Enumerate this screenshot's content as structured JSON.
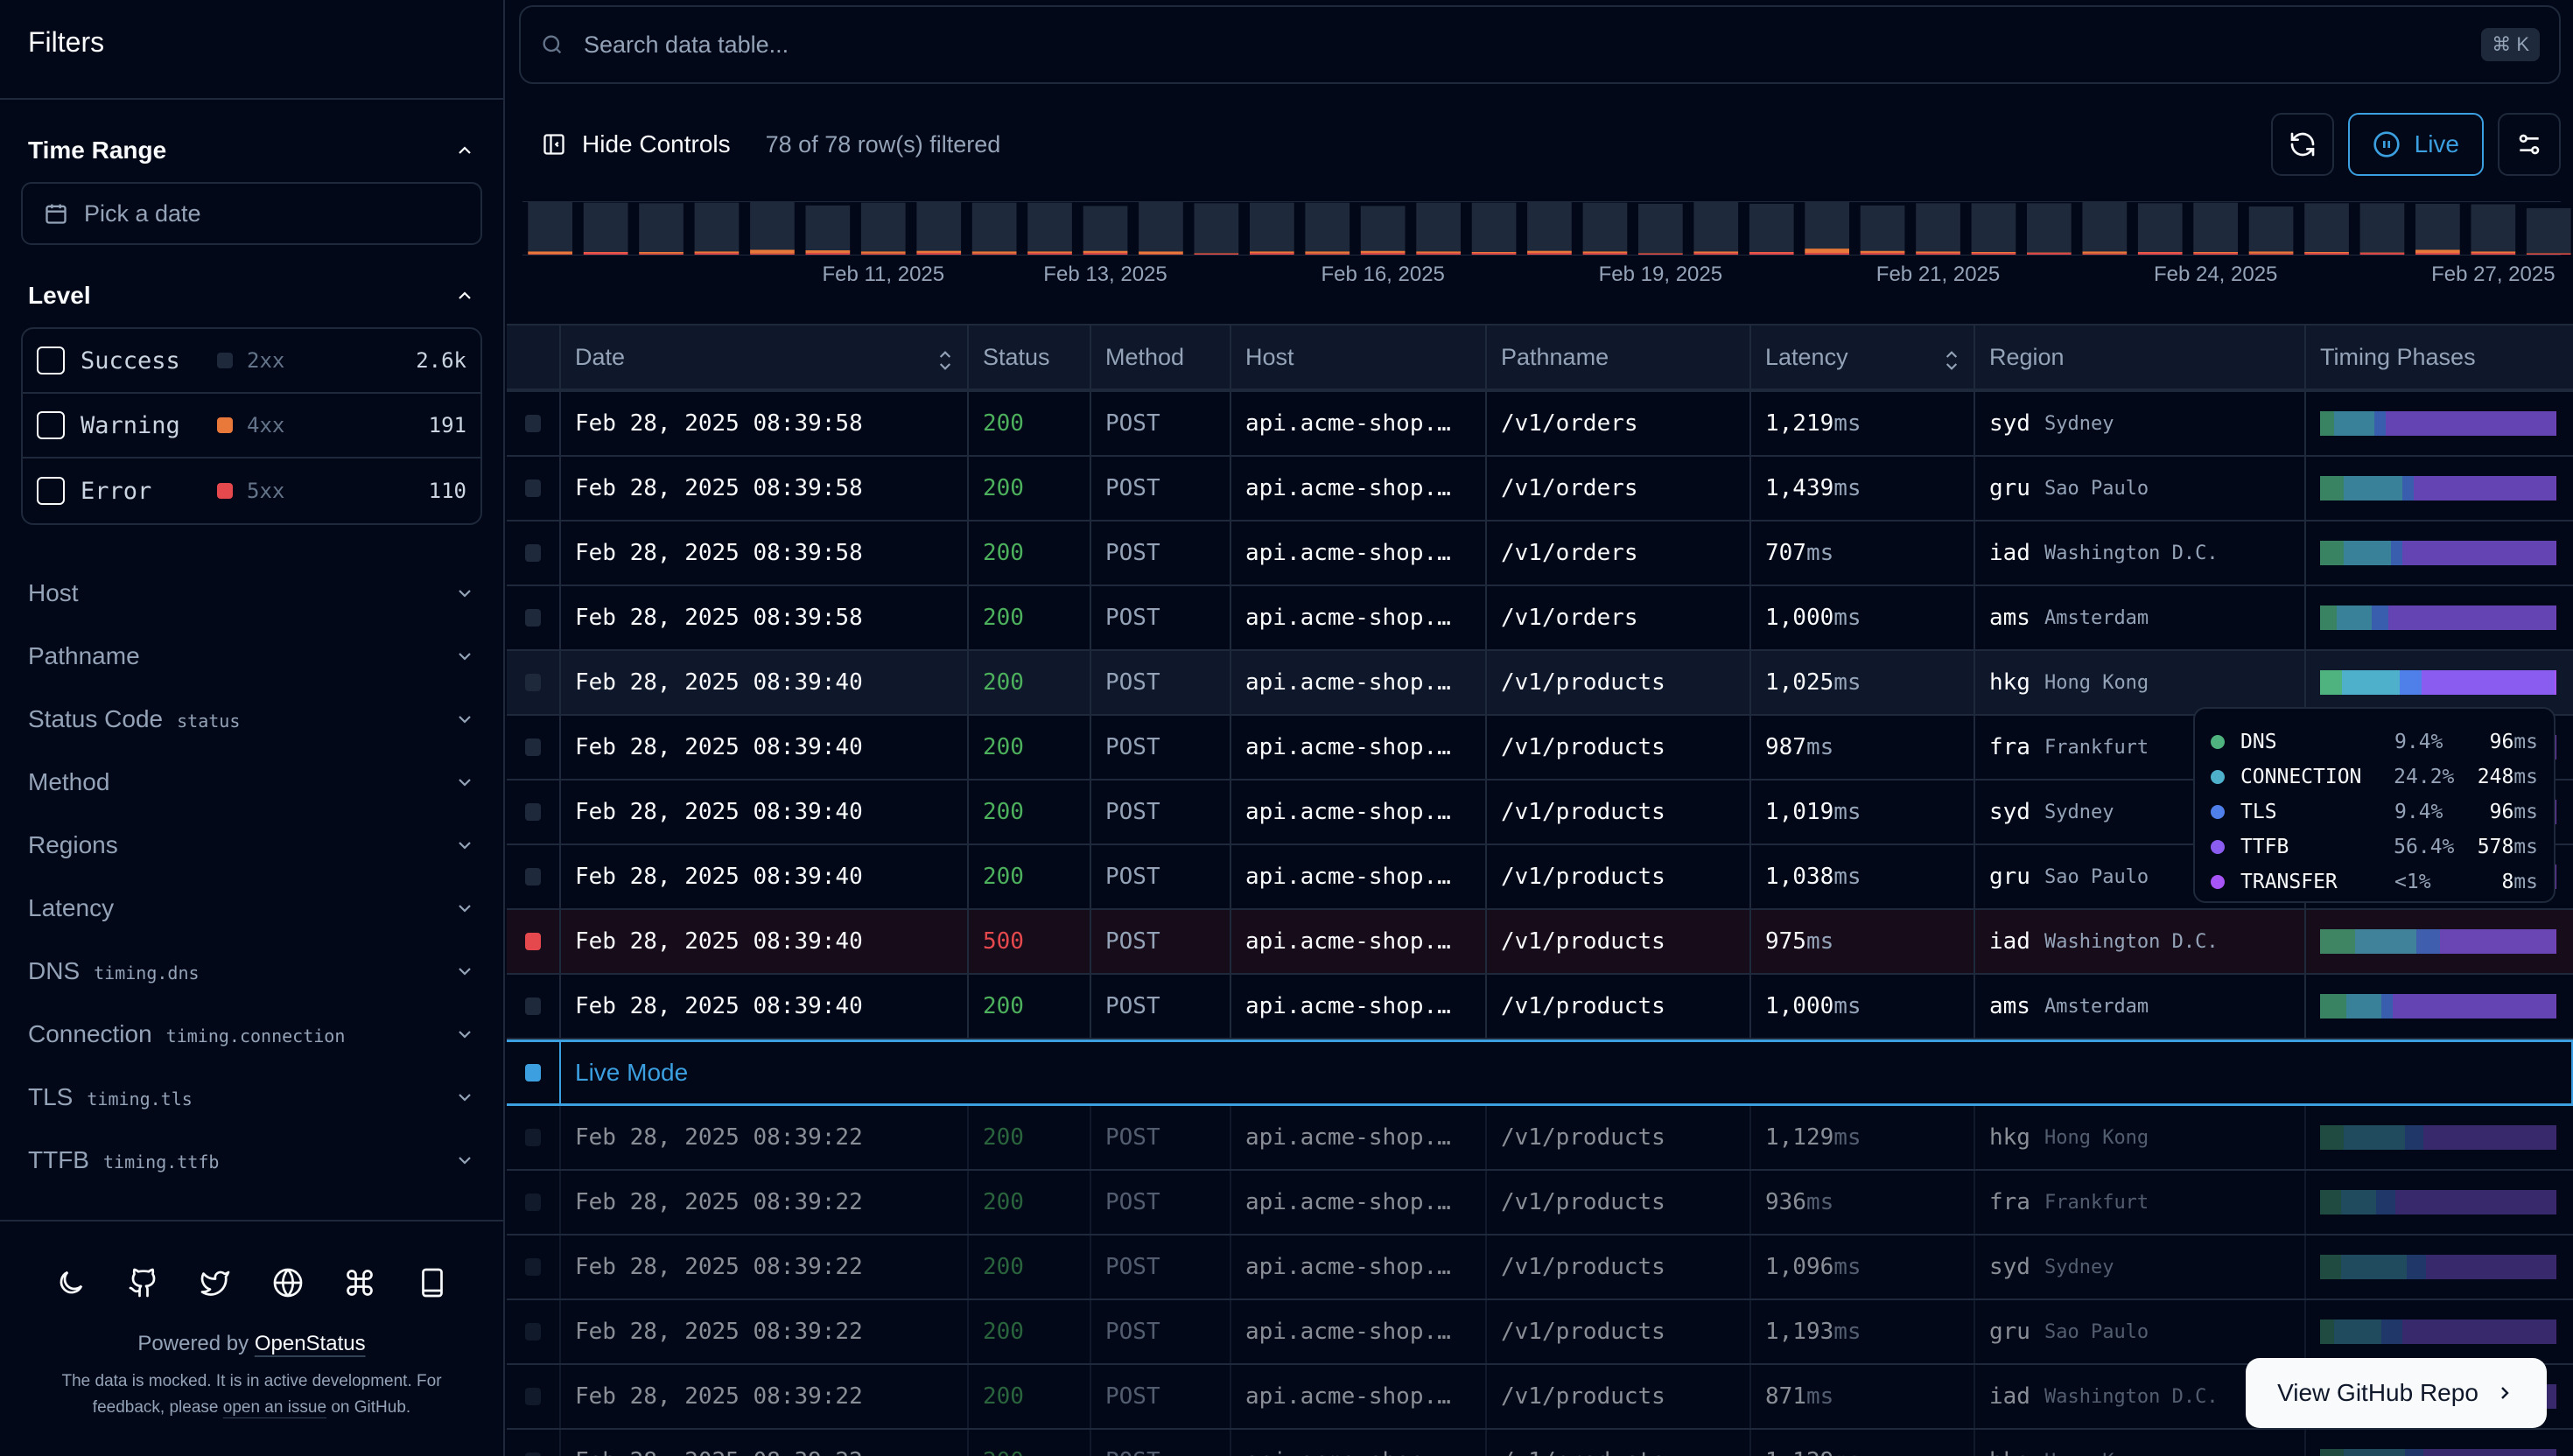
{
  "sidebar": {
    "title": "Filters",
    "time_range": {
      "label": "Time Range",
      "placeholder": "Pick a date"
    },
    "level": {
      "label": "Level",
      "items": [
        {
          "name": "Success",
          "code": "2xx",
          "count": "2.6k",
          "color": "#1e293b"
        },
        {
          "name": "Warning",
          "code": "4xx",
          "count": "191",
          "color": "#e8793a"
        },
        {
          "name": "Error",
          "code": "5xx",
          "count": "110",
          "color": "#e5484d"
        }
      ]
    },
    "filter_groups": [
      {
        "label": "Host",
        "sub": ""
      },
      {
        "label": "Pathname",
        "sub": ""
      },
      {
        "label": "Status Code",
        "sub": "status"
      },
      {
        "label": "Method",
        "sub": ""
      },
      {
        "label": "Regions",
        "sub": ""
      },
      {
        "label": "Latency",
        "sub": ""
      },
      {
        "label": "DNS",
        "sub": "timing.dns"
      },
      {
        "label": "Connection",
        "sub": "timing.connection"
      },
      {
        "label": "TLS",
        "sub": "timing.tls"
      },
      {
        "label": "TTFB",
        "sub": "timing.ttfb"
      }
    ],
    "footer": {
      "icons": [
        "moon-icon",
        "github-icon",
        "twitter-icon",
        "globe-icon",
        "command-icon",
        "book-icon"
      ],
      "powered_prefix": "Powered by",
      "powered_link": "OpenStatus",
      "notice_1": "The data is mocked. It is in active development. For feedback, please",
      "notice_link": "open an issue",
      "notice_2": "on GitHub."
    }
  },
  "search": {
    "placeholder": "Search data table...",
    "shortcut": "⌘ K"
  },
  "controls": {
    "hide_controls": "Hide Controls",
    "row_count": "78 of 78 row(s) filtered",
    "live_label": "Live"
  },
  "histogram": {
    "labels": [
      {
        "text": "Feb 11, 2025",
        "index": 6
      },
      {
        "text": "Feb 13, 2025",
        "index": 10
      },
      {
        "text": "Feb 16, 2025",
        "index": 15
      },
      {
        "text": "Feb 19, 2025",
        "index": 20
      },
      {
        "text": "Feb 21, 2025",
        "index": 25
      },
      {
        "text": "Feb 24, 2025",
        "index": 30
      },
      {
        "text": "Feb 27, 2025",
        "index": 35
      }
    ],
    "colors": {
      "success": "#1e293b",
      "warning": "#e8793a",
      "error": "#e5484d"
    }
  },
  "chart_data": {
    "type": "bar",
    "title": "",
    "stacked": true,
    "categories_count": 37,
    "series": [
      {
        "name": "Success",
        "values": [
          90,
          90,
          89,
          89,
          88,
          82,
          89,
          89,
          89,
          89,
          82,
          90,
          91,
          89,
          89,
          82,
          89,
          90,
          89,
          89,
          90,
          90,
          88,
          92,
          83,
          88,
          89,
          90,
          90,
          89,
          90,
          82,
          89,
          90,
          84,
          86,
          82
        ]
      },
      {
        "name": "Warning",
        "values": [
          5,
          1,
          3,
          3,
          7,
          5,
          4,
          4,
          4,
          3,
          4,
          5,
          1,
          3,
          4,
          4,
          3,
          2,
          4,
          3,
          1,
          3,
          1,
          8,
          4,
          3,
          2,
          1,
          4,
          1,
          2,
          4,
          2,
          1,
          6,
          3,
          1
        ]
      },
      {
        "name": "Error",
        "values": [
          1,
          4,
          2,
          3,
          2,
          3,
          2,
          3,
          2,
          3,
          3,
          1,
          2,
          3,
          2,
          3,
          3,
          3,
          3,
          3,
          2,
          3,
          4,
          3,
          3,
          3,
          3,
          3,
          2,
          4,
          3,
          2,
          3,
          3,
          3,
          3,
          2
        ]
      }
    ],
    "xlabel": "",
    "ylabel": ""
  },
  "table": {
    "columns": [
      "",
      "Date",
      "Status",
      "Method",
      "Host",
      "Pathname",
      "Latency",
      "Region",
      "Timing Phases"
    ],
    "sortable": [
      false,
      true,
      false,
      false,
      false,
      false,
      true,
      false,
      false
    ],
    "latency_unit": "ms",
    "phase_colors": [
      "#4fb37f",
      "#4fb0cc",
      "#4f7fe8",
      "#8a5cf0",
      "#a855f7"
    ],
    "rows": [
      {
        "date": "Feb 28, 2025 08:39:58",
        "status": "200",
        "method": "POST",
        "host": "api.acme-shop.…",
        "path": "/v1/orders",
        "latency": "1,219",
        "region": "syd",
        "city": "Sydney",
        "phases": [
          6,
          17,
          5,
          72,
          0.5
        ],
        "state": "normal"
      },
      {
        "date": "Feb 28, 2025 08:39:58",
        "status": "200",
        "method": "POST",
        "host": "api.acme-shop.…",
        "path": "/v1/orders",
        "latency": "1,439",
        "region": "gru",
        "city": "Sao Paulo",
        "phases": [
          10,
          25,
          5,
          60,
          0.5
        ],
        "state": "normal"
      },
      {
        "date": "Feb 28, 2025 08:39:58",
        "status": "200",
        "method": "POST",
        "host": "api.acme-shop.…",
        "path": "/v1/orders",
        "latency": "707",
        "region": "iad",
        "city": "Washington D.C.",
        "phases": [
          10,
          20,
          5,
          65,
          0.5
        ],
        "state": "normal"
      },
      {
        "date": "Feb 28, 2025 08:39:58",
        "status": "200",
        "method": "POST",
        "host": "api.acme-shop.…",
        "path": "/v1/orders",
        "latency": "1,000",
        "region": "ams",
        "city": "Amsterdam",
        "phases": [
          7,
          15,
          7,
          71,
          0.5
        ],
        "state": "normal"
      },
      {
        "date": "Feb 28, 2025 08:39:40",
        "status": "200",
        "method": "POST",
        "host": "api.acme-shop.…",
        "path": "/v1/products",
        "latency": "1,025",
        "region": "hkg",
        "city": "Hong Kong",
        "phases": [
          9.4,
          24.2,
          9.4,
          56.4,
          0.6
        ],
        "state": "hover"
      },
      {
        "date": "Feb 28, 2025 08:39:40",
        "status": "200",
        "method": "POST",
        "host": "api.acme-shop.…",
        "path": "/v1/products",
        "latency": "987",
        "region": "fra",
        "city": "Frankfurt",
        "phases": [
          9,
          22,
          8,
          61,
          0.5
        ],
        "state": "normal"
      },
      {
        "date": "Feb 28, 2025 08:39:40",
        "status": "200",
        "method": "POST",
        "host": "api.acme-shop.…",
        "path": "/v1/products",
        "latency": "1,019",
        "region": "syd",
        "city": "Sydney",
        "phases": [
          9,
          22,
          8,
          61,
          0.5
        ],
        "state": "normal"
      },
      {
        "date": "Feb 28, 2025 08:39:40",
        "status": "200",
        "method": "POST",
        "host": "api.acme-shop.…",
        "path": "/v1/products",
        "latency": "1,038",
        "region": "gru",
        "city": "Sao Paulo",
        "phases": [
          9,
          22,
          8,
          61,
          0.5
        ],
        "state": "normal"
      },
      {
        "date": "Feb 28, 2025 08:39:40",
        "status": "500",
        "method": "POST",
        "host": "api.acme-shop.…",
        "path": "/v1/products",
        "latency": "975",
        "region": "iad",
        "city": "Washington D.C.",
        "phases": [
          15,
          26,
          10,
          49,
          0.5
        ],
        "state": "error"
      },
      {
        "date": "Feb 28, 2025 08:39:40",
        "status": "200",
        "method": "POST",
        "host": "api.acme-shop.…",
        "path": "/v1/products",
        "latency": "1,000",
        "region": "ams",
        "city": "Amsterdam",
        "phases": [
          11,
          15,
          5,
          69,
          0.5
        ],
        "state": "normal"
      }
    ],
    "live_mode_label": "Live Mode",
    "old_rows": [
      {
        "date": "Feb 28, 2025 08:39:22",
        "status": "200",
        "method": "POST",
        "host": "api.acme-shop.…",
        "path": "/v1/products",
        "latency": "1,129",
        "region": "hkg",
        "city": "Hong Kong",
        "phases": [
          10,
          26,
          8,
          56,
          0.5
        ]
      },
      {
        "date": "Feb 28, 2025 08:39:22",
        "status": "200",
        "method": "POST",
        "host": "api.acme-shop.…",
        "path": "/v1/products",
        "latency": "936",
        "region": "fra",
        "city": "Frankfurt",
        "phases": [
          9,
          15,
          8,
          68,
          0.5
        ]
      },
      {
        "date": "Feb 28, 2025 08:39:22",
        "status": "200",
        "method": "POST",
        "host": "api.acme-shop.…",
        "path": "/v1/products",
        "latency": "1,096",
        "region": "syd",
        "city": "Sydney",
        "phases": [
          9,
          28,
          8,
          55,
          0.5
        ]
      },
      {
        "date": "Feb 28, 2025 08:39:22",
        "status": "200",
        "method": "POST",
        "host": "api.acme-shop.…",
        "path": "/v1/products",
        "latency": "1,193",
        "region": "gru",
        "city": "Sao Paulo",
        "phases": [
          6,
          20,
          9,
          65,
          0.5
        ]
      },
      {
        "date": "Feb 28, 2025 08:39:22",
        "status": "200",
        "method": "POST",
        "host": "api.acme-shop.…",
        "path": "/v1/products",
        "latency": "871",
        "region": "iad",
        "city": "Washington D.C.",
        "phases": [
          13,
          13,
          9,
          65,
          0.5
        ]
      }
    ]
  },
  "tooltip": {
    "rows": [
      {
        "name": "DNS",
        "pct": "9.4%",
        "ms": "96",
        "color": "#4fb37f"
      },
      {
        "name": "CONNECTION",
        "pct": "24.2%",
        "ms": "248",
        "color": "#4fb0cc"
      },
      {
        "name": "TLS",
        "pct": "9.4%",
        "ms": "96",
        "color": "#4f7fe8"
      },
      {
        "name": "TTFB",
        "pct": "56.4%",
        "ms": "578",
        "color": "#8a5cf0"
      },
      {
        "name": "TRANSFER",
        "pct": "<1%",
        "ms": "8",
        "color": "#a855f7"
      }
    ],
    "unit": "ms"
  },
  "github_button": {
    "label": "View GitHub Repo"
  }
}
